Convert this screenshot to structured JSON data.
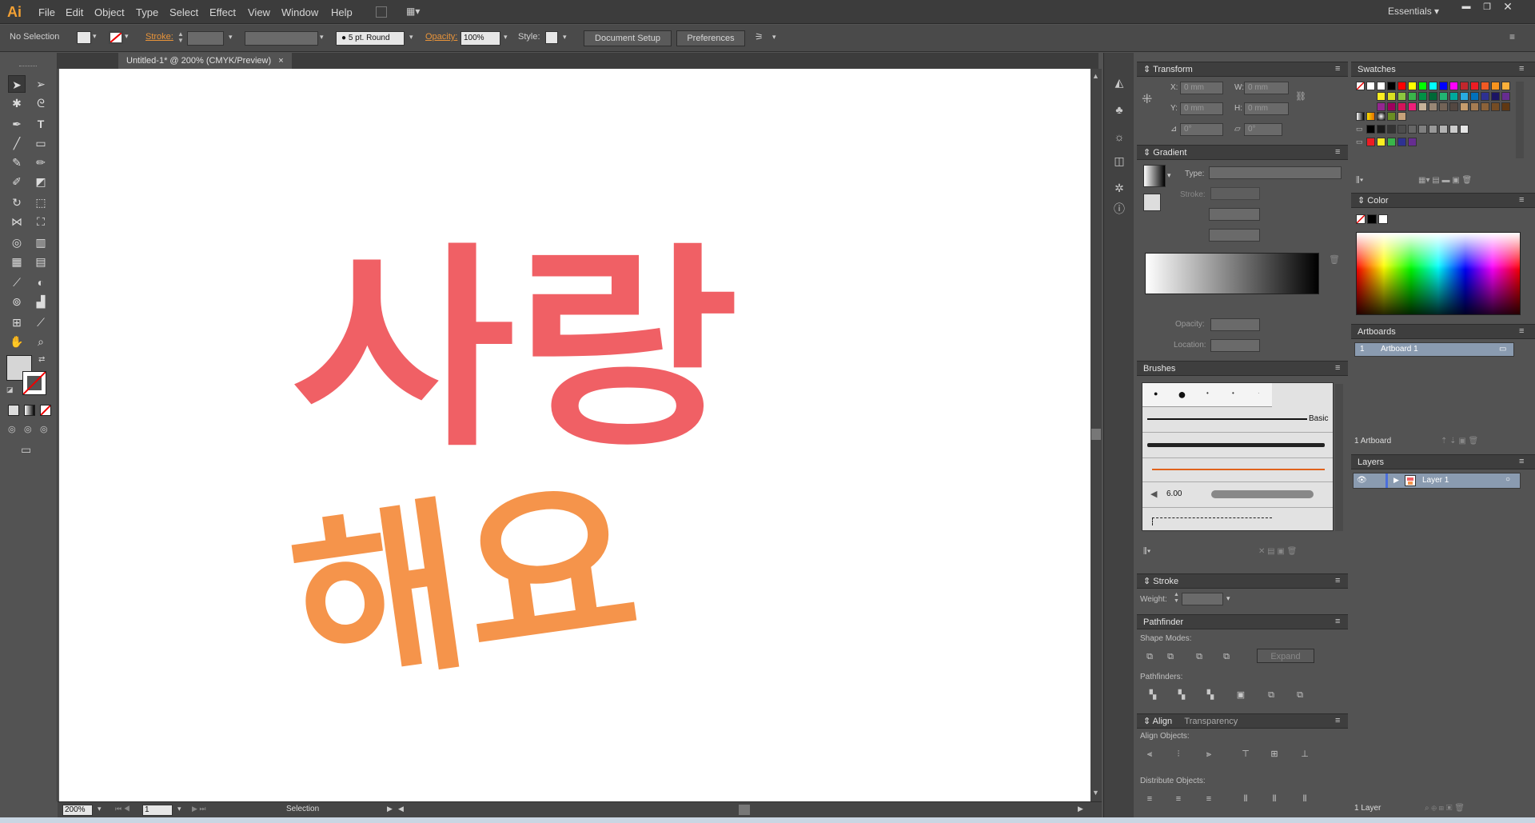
{
  "app": {
    "logo": "Ai",
    "workspace": "Essentials"
  },
  "menu": [
    "File",
    "Edit",
    "Object",
    "Type",
    "Select",
    "Effect",
    "View",
    "Window",
    "Help"
  ],
  "control": {
    "selection": "No Selection",
    "stroke_label": "Stroke:",
    "brush": "5 pt. Round",
    "opacity_label": "Opacity:",
    "opacity_value": "100%",
    "style_label": "Style:",
    "doc_setup": "Document Setup",
    "preferences": "Preferences"
  },
  "document": {
    "tab_title": "Untitled-1* @ 200% (CMYK/Preview)",
    "close": "×"
  },
  "artwork": {
    "line1": "사랑",
    "line2": "해요",
    "color1": "#f06065",
    "color2": "#f5944b"
  },
  "status": {
    "zoom": "200%",
    "artboard_num": "1",
    "tool": "Selection"
  },
  "transform": {
    "title": "Transform",
    "x_label": "X:",
    "y_label": "Y:",
    "w_label": "W:",
    "h_label": "H:",
    "x": "0 mm",
    "y": "0 mm",
    "w": "0 mm",
    "h": "0 mm",
    "angle": "0°",
    "shear": "0°"
  },
  "gradient": {
    "title": "Gradient",
    "type_label": "Type:",
    "stroke_label": "Stroke:",
    "opacity_label": "Opacity:",
    "location_label": "Location:"
  },
  "brushes": {
    "title": "Brushes",
    "basic": "Basic",
    "size": "6.00"
  },
  "stroke": {
    "title": "Stroke",
    "weight_label": "Weight:"
  },
  "pathfinder": {
    "title": "Pathfinder",
    "shape_modes": "Shape Modes:",
    "expand": "Expand",
    "pathfinders": "Pathfinders:"
  },
  "align": {
    "title": "Align",
    "tab2": "Transparency",
    "align_objects": "Align Objects:",
    "distribute_objects": "Distribute Objects:"
  },
  "swatches": {
    "title": "Swatches",
    "colors": [
      "#ffffff",
      "#000000",
      "#ff0000",
      "#ffff00",
      "#00ff00",
      "#00ffff",
      "#0000ff",
      "#ff00ff",
      "#c1272d",
      "#ed1c24",
      "#f15a24",
      "#f7931e",
      "#fbb03b",
      "#fcee21",
      "#d9e021",
      "#8cc63f",
      "#39b54a",
      "#009245",
      "#006837",
      "#22b573",
      "#00a99d",
      "#29abe2",
      "#0071bc",
      "#2e3192",
      "#1b1464",
      "#662d91",
      "#93278f",
      "#9e005d",
      "#d4145a",
      "#ed1e79",
      "#c7b299",
      "#998675",
      "#736357",
      "#534741",
      "#c69c6d",
      "#a67c52",
      "#8c6239",
      "#754c24",
      "#603813",
      "#42210b"
    ],
    "grays": [
      "#000000",
      "#1a1a1a",
      "#333333",
      "#4d4d4d",
      "#666666",
      "#808080",
      "#999999",
      "#b3b3b3",
      "#cccccc",
      "#e6e6e6"
    ],
    "group": [
      "#ed1c24",
      "#fcee21",
      "#39b54a",
      "#2e3192",
      "#662d91"
    ]
  },
  "color": {
    "title": "Color"
  },
  "artboards": {
    "title": "Artboards",
    "num": "1",
    "name": "Artboard 1",
    "count": "1 Artboard"
  },
  "layers": {
    "title": "Layers",
    "name": "Layer 1",
    "count": "1 Layer"
  }
}
